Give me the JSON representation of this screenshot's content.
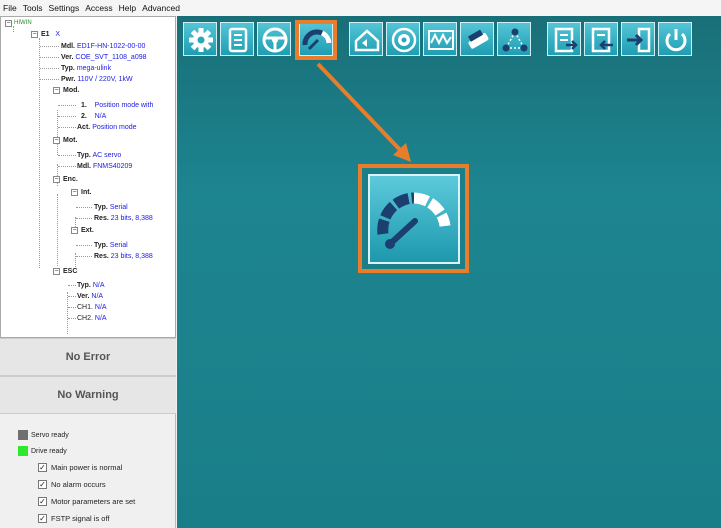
{
  "menu": [
    "File",
    "Tools",
    "Settings",
    "Access",
    "Help",
    "Advanced"
  ],
  "tree": {
    "root": "HIWIN",
    "e1": {
      "key": "E1",
      "value": "X"
    },
    "mdl": {
      "key": "Mdl.",
      "value": "ED1F-HN-1022-00-00"
    },
    "ver": {
      "key": "Ver.",
      "value": "COE_SVT_1108_a098"
    },
    "typ": {
      "key": "Typ.",
      "value": "mega-ulink"
    },
    "pwr": {
      "key": "Pwr.",
      "value": "110V / 220V, 1kW"
    },
    "mod": {
      "key": "Mod.",
      "m1": {
        "key": "1.",
        "value": "Position mode with"
      },
      "m2": {
        "key": "2.",
        "value": "N/A"
      },
      "act": {
        "key": "Act.",
        "value": "Position mode"
      }
    },
    "mot": {
      "key": "Mot.",
      "typ": {
        "key": "Typ.",
        "value": "AC servo"
      },
      "mdl": {
        "key": "Mdl.",
        "value": "FNMS40209"
      }
    },
    "enc": {
      "key": "Enc.",
      "int": {
        "key": "Int.",
        "typ": {
          "key": "Typ.",
          "value": "Serial"
        },
        "res": {
          "key": "Res.",
          "value": "23 bits, 8,388"
        }
      },
      "ext": {
        "key": "Ext.",
        "typ": {
          "key": "Typ.",
          "value": "Serial"
        },
        "res": {
          "key": "Res.",
          "value": "23 bits, 8,388"
        }
      }
    },
    "esc": {
      "key": "ESC",
      "typ": {
        "key": "Typ.",
        "value": "N/A"
      },
      "ver": {
        "key": "Ver.",
        "value": "N/A"
      },
      "ch1": {
        "key": "CH1.",
        "value": "N/A"
      },
      "ch2": {
        "key": "CH2.",
        "value": "N/A"
      }
    }
  },
  "status": {
    "error": "No Error",
    "warning": "No Warning"
  },
  "indicators": [
    {
      "label": "Servo ready",
      "color": "#707070"
    },
    {
      "label": "Drive ready",
      "color": "#2ee82e"
    }
  ],
  "checks": [
    {
      "label": "Main power is normal",
      "checked": true
    },
    {
      "label": "No alarm occurs",
      "checked": true
    },
    {
      "label": "Motor parameters are set",
      "checked": true
    },
    {
      "label": "FSTP signal is off",
      "checked": true
    }
  ],
  "toolbar": [
    "gear-icon",
    "document-icon",
    "steering-wheel-icon",
    "speedometer-icon",
    "home-icon",
    "eye-icon",
    "waveform-icon",
    "tools-icon",
    "network-icon",
    "export-icon",
    "import-icon",
    "login-icon",
    "power-icon"
  ],
  "colors": {
    "highlight": "#e87d2c",
    "panel": "#1d8590",
    "button": "#2aa7bb"
  }
}
